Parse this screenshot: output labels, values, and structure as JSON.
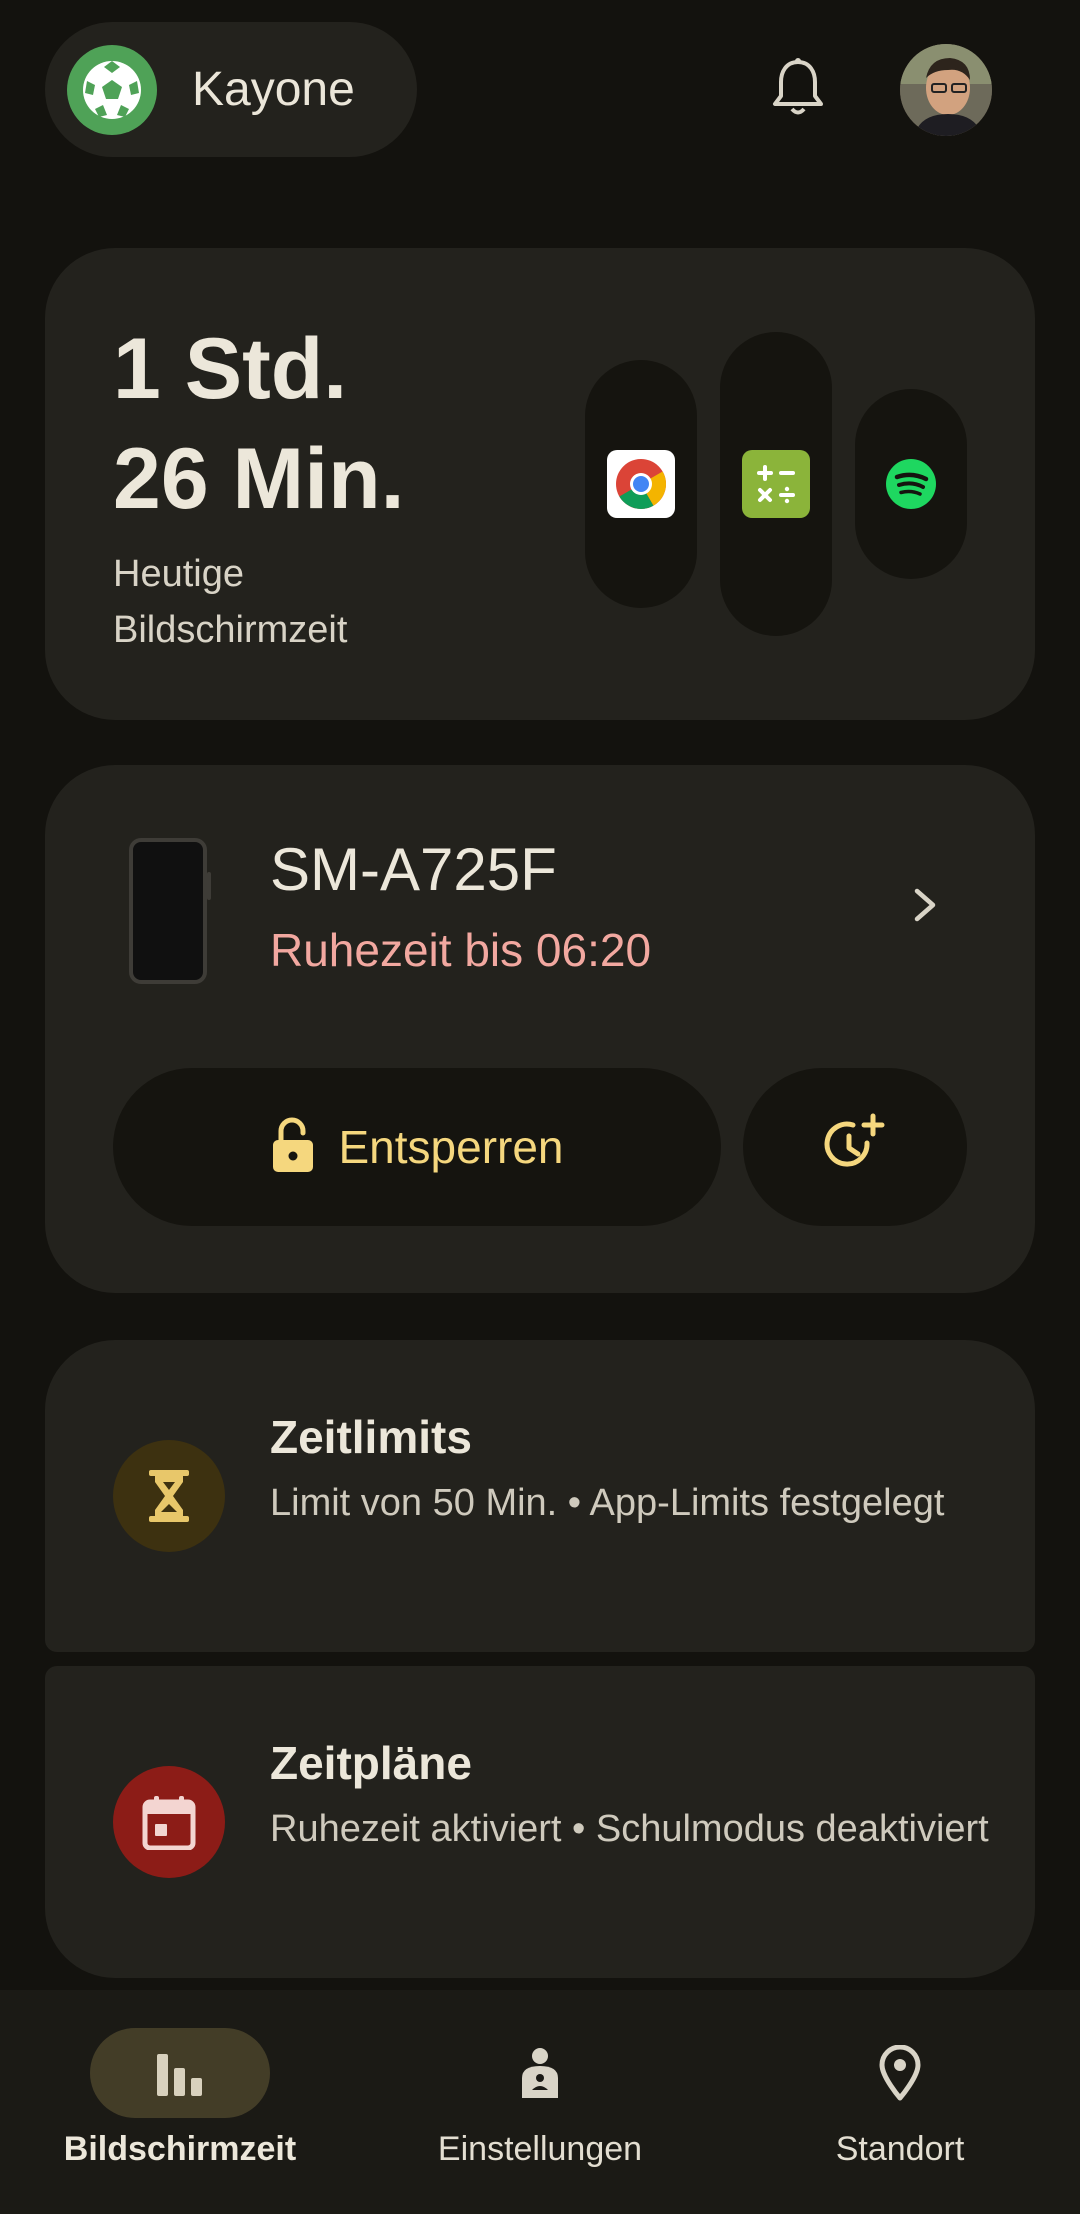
{
  "header": {
    "profile_name": "Kayone",
    "profile_icon": "soccer-ball-icon",
    "notifications_icon": "bell-icon",
    "user_avatar": "user-avatar"
  },
  "screen_time": {
    "hours": "1 Std.",
    "minutes": "26 Min.",
    "label": "Heutige Bildschirmzeit",
    "apps": [
      {
        "icon": "chrome-icon"
      },
      {
        "icon": "calculator-icon"
      },
      {
        "icon": "spotify-icon"
      }
    ]
  },
  "device": {
    "name": "SM-A725F",
    "status": "Ruhezeit bis 06:20",
    "unlock_label": "Entsperren",
    "unlock_icon": "unlock-icon",
    "bonus_icon": "add-time-icon"
  },
  "limits": {
    "title": "Zeitlimits",
    "subtitle": "Limit von 50 Min. • App-Limits festgelegt",
    "icon": "hourglass-icon"
  },
  "schedules": {
    "title": "Zeitpläne",
    "subtitle": "Ruhezeit aktiviert • Schulmodus deaktiviert",
    "icon": "calendar-icon"
  },
  "nav": {
    "items": [
      {
        "label": "Bildschirmzeit",
        "icon": "bar-chart-icon",
        "active": true
      },
      {
        "label": "Einstellungen",
        "icon": "person-icon",
        "active": false
      },
      {
        "label": "Standort",
        "icon": "location-pin-icon",
        "active": false
      }
    ]
  },
  "colors": {
    "background": "#13120e",
    "card": "#23221d",
    "accent_yellow": "#f5d77e",
    "status_red": "#f2a8a0",
    "limits_icon_bg": "#3d3110",
    "schedules_icon_bg": "#8c1c17"
  }
}
